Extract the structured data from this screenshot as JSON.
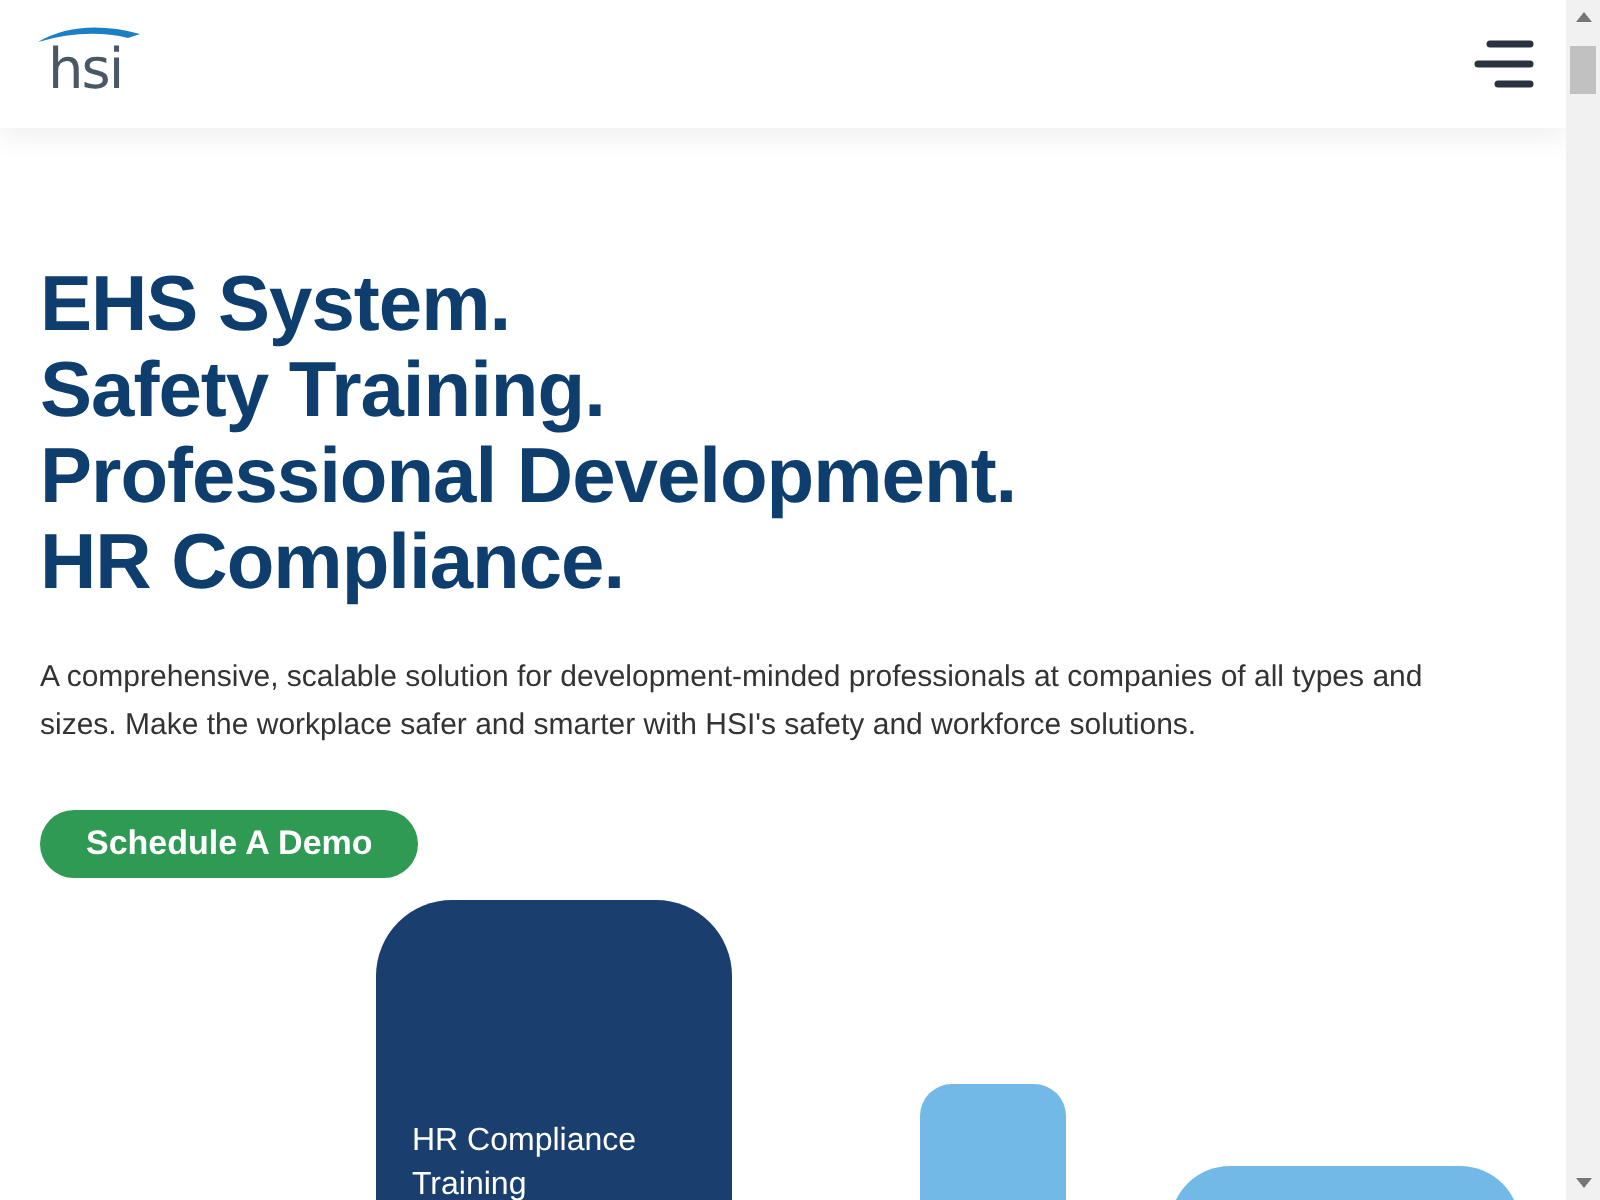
{
  "header": {
    "logo": "hsi"
  },
  "hero": {
    "headline": [
      "EHS System.",
      "Safety Training.",
      "Professional Development.",
      "HR Compliance."
    ],
    "description": "A comprehensive, scalable solution for development-minded professionals at companies of all types and sizes. Make the workplace safer and smarter with HSI's safety and workforce solutions.",
    "cta": "Schedule A Demo"
  },
  "tiles": [
    {
      "label": "HR Compliance Training"
    }
  ]
}
